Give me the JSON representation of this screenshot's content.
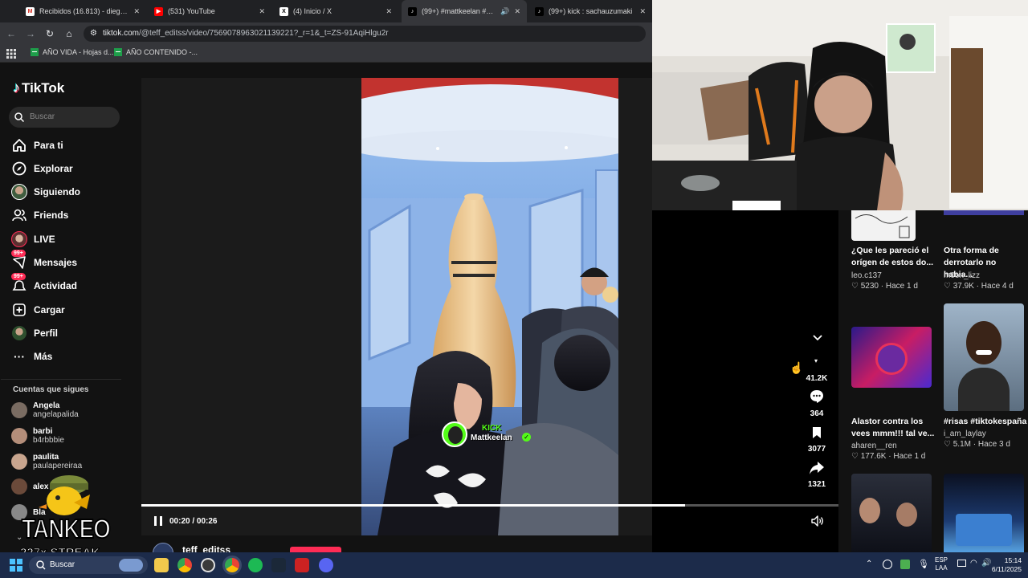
{
  "browser": {
    "tabs": [
      {
        "title": "Recibidos (16.813) - diegooalia",
        "favicon": "gmail-icon"
      },
      {
        "title": "(531) YouTube",
        "favicon": "youtube-icon"
      },
      {
        "title": "(4) Inicio / X",
        "favicon": "x-icon"
      },
      {
        "title": "(99+) #mattkeelan #kick #",
        "favicon": "tiktok-icon",
        "active": true
      },
      {
        "title": "(99+) kick : sachauzumaki",
        "favicon": "tiktok-icon"
      }
    ],
    "url_host": "tiktok.com",
    "url_path": "/@teff_editss/video/7569078963021139221?_r=1&_t=ZS-91AqiHlgu2r",
    "bookmarks": [
      "AÑO VIDA - Hojas d...",
      "AÑO CONTENIDO -..."
    ]
  },
  "sidebar": {
    "logo": "TikTok",
    "search_placeholder": "Buscar",
    "nav": [
      {
        "label": "Para ti",
        "icon": "home-icon"
      },
      {
        "label": "Explorar",
        "icon": "compass-icon"
      },
      {
        "label": "Siguiendo",
        "icon": "avatar-icon"
      },
      {
        "label": "Friends",
        "icon": "friends-icon"
      },
      {
        "label": "LIVE",
        "icon": "live-icon"
      },
      {
        "label": "Mensajes",
        "icon": "messages-icon",
        "badge": "99+"
      },
      {
        "label": "Actividad",
        "icon": "activity-icon",
        "badge": "99+"
      },
      {
        "label": "Cargar",
        "icon": "upload-icon"
      },
      {
        "label": "Perfil",
        "icon": "profile-icon"
      },
      {
        "label": "Más",
        "icon": "more-icon"
      }
    ],
    "following_header": "Cuentas que sigues",
    "following": [
      {
        "name": "Angela",
        "handle": "angelapalida",
        "color": "#7a6c62"
      },
      {
        "name": "barbi",
        "handle": "b4rbbbie",
        "color": "#b48e7a"
      },
      {
        "name": "paulita",
        "handle": "paulapereiraa",
        "color": "#c8a58e"
      },
      {
        "name": "alex",
        "handle": "",
        "color": "#6b4a3a"
      },
      {
        "name": "Bla",
        "handle": "",
        "color": "#888888"
      }
    ]
  },
  "overlay": {
    "tank_text": "TANKEO",
    "streak_text": "227x STREAK"
  },
  "video": {
    "time": "00:20 / 00:26",
    "progress": 0.78,
    "kick_label": "KICK",
    "kick_user": "Mattkeelan",
    "author": "teff_editss",
    "likes": "41.2K",
    "comments": "364",
    "saves": "3077",
    "shares": "1321"
  },
  "feed": [
    {
      "title": "¿Que les pareció el orígen de estos do...",
      "author": "leo.c137",
      "likes": "5230",
      "age": "Hace 1 d"
    },
    {
      "title": "Otra forma de derrotarlo no habia...",
      "author": "m0on_lizz",
      "likes": "37.9K",
      "age": "Hace 4 d"
    },
    {
      "title": "Alastor contra los vees mmm!!! tal ve...",
      "author": "aharen__ren",
      "likes": "177.6K",
      "age": "Hace 1 d"
    },
    {
      "title": "#risas #tiktokespaña",
      "author": "i_am_laylay",
      "likes": "5.1M",
      "age": "Hace 3 d"
    }
  ],
  "taskbar": {
    "search": "Buscar",
    "lang_top": "ESP",
    "lang_bottom": "LAA",
    "time": "15:14",
    "date": "6/11/2025"
  }
}
